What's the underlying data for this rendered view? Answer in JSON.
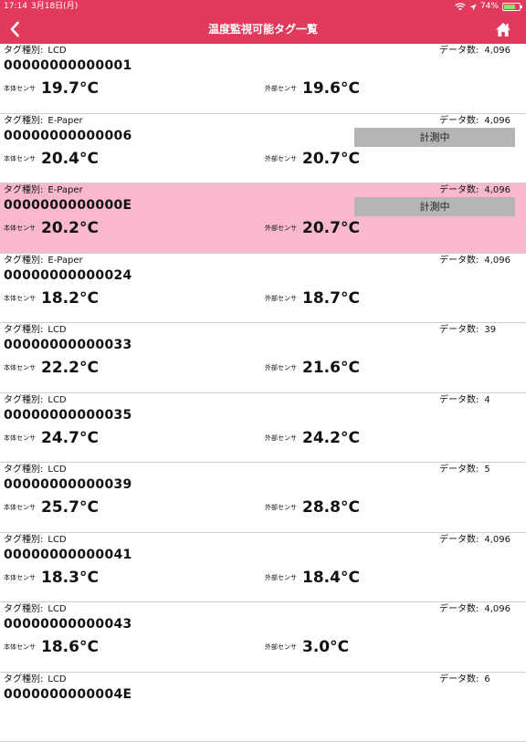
{
  "status_bar": {
    "time": "17:14",
    "date": "3月18日(月)",
    "battery_percent": "74%",
    "battery_level": 0.74
  },
  "header": {
    "title": "温度監視可能タグ一覧",
    "background_color": "#e23a5d"
  },
  "labels": {
    "tag_type": "タグ種別:",
    "data_count": "データ数:",
    "body_sensor": "本体センサ",
    "external_sensor": "外部センサ",
    "measuring": "計測中"
  },
  "tags": [
    {
      "type": "LCD",
      "id": "00000000000001",
      "count": "4,096",
      "body": "19.7°C",
      "external": "19.6°C",
      "measuring": false,
      "selected": false
    },
    {
      "type": "E-Paper",
      "id": "00000000000006",
      "count": "4,096",
      "body": "20.4°C",
      "external": "20.7°C",
      "measuring": true,
      "selected": false
    },
    {
      "type": "E-Paper",
      "id": "0000000000000E",
      "count": "4,096",
      "body": "20.2°C",
      "external": "20.7°C",
      "measuring": true,
      "selected": true
    },
    {
      "type": "E-Paper",
      "id": "00000000000024",
      "count": "4,096",
      "body": "18.2°C",
      "external": "18.7°C",
      "measuring": false,
      "selected": false
    },
    {
      "type": "LCD",
      "id": "00000000000033",
      "count": "39",
      "body": "22.2°C",
      "external": "21.6°C",
      "measuring": false,
      "selected": false
    },
    {
      "type": "LCD",
      "id": "00000000000035",
      "count": "4",
      "body": "24.7°C",
      "external": "24.2°C",
      "measuring": false,
      "selected": false
    },
    {
      "type": "LCD",
      "id": "00000000000039",
      "count": "5",
      "body": "25.7°C",
      "external": "28.8°C",
      "measuring": false,
      "selected": false
    },
    {
      "type": "LCD",
      "id": "00000000000041",
      "count": "4,096",
      "body": "18.3°C",
      "external": "18.4°C",
      "measuring": false,
      "selected": false
    },
    {
      "type": "LCD",
      "id": "00000000000043",
      "count": "4,096",
      "body": "18.6°C",
      "external": "3.0°C",
      "measuring": false,
      "selected": false
    },
    {
      "type": "LCD",
      "id": "0000000000004E",
      "count": "6",
      "body": "",
      "external": "",
      "measuring": false,
      "selected": false
    }
  ]
}
